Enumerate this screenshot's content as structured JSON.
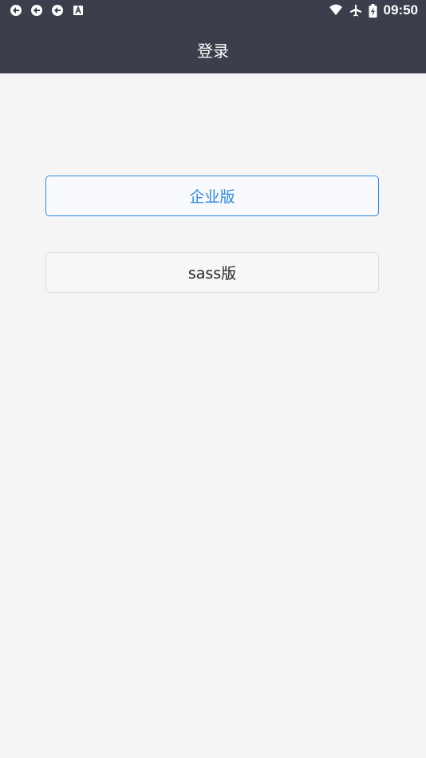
{
  "status_bar": {
    "time": "09:50",
    "left_icons": [
      "sync-icon",
      "sync-icon",
      "sync-icon",
      "a-box-icon"
    ],
    "right_icons": [
      "wifi-icon",
      "airplane-icon",
      "battery-icon"
    ]
  },
  "header": {
    "title": "登录",
    "background": "#3b3f4b"
  },
  "options": {
    "enterprise_label": "企业版",
    "sass_label": "sass版",
    "accent_color": "#2f8ae0"
  }
}
